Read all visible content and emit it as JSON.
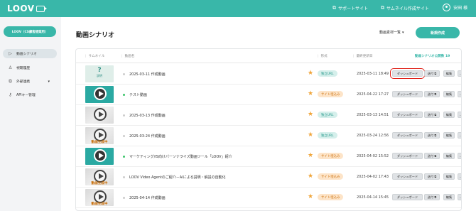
{
  "header": {
    "logo": "LOOV",
    "links": [
      "サポートサイト",
      "サムネイル作成サイト"
    ],
    "user_name": "安田 様"
  },
  "sidebar": {
    "org_label": "LOOV（CS顧客提案用）",
    "items": [
      {
        "label": "動画シナリオ",
        "icon": "play-circle-icon",
        "active": true
      },
      {
        "label": "視聴履歴",
        "icon": "users-icon",
        "active": false
      },
      {
        "label": "外部連携",
        "icon": "external-link-icon",
        "active": false
      },
      {
        "label": "APIキー管理",
        "icon": "key-icon",
        "active": false
      }
    ]
  },
  "main": {
    "title": "動画シナリオ",
    "assets_link": "動画素材一覧",
    "new_button": "新規作成",
    "columns": {
      "thumbnail": "サムネイル",
      "name": "動画名",
      "format": "形式",
      "updated": "最終更新日",
      "public_count": "動画シナリオ公開数",
      "public_count_value": "19"
    },
    "row_buttons": {
      "dashboard": "ダッシュボード",
      "send": "送付",
      "edit": "編集",
      "more": "…"
    },
    "thumb_question_mark": "?",
    "thumb_question_text": "説明",
    "generating_text": "動画生成中",
    "rows": [
      {
        "thumb": "question",
        "dot": "gray",
        "name": "2025-03-11 作成動画",
        "format": "独立URL",
        "format_type": "ind",
        "date": "2025-03-11 18:49",
        "highlight": true
      },
      {
        "thumb": "video",
        "dot": "green",
        "name": "テスト動画",
        "format": "サイト埋込み",
        "format_type": "site",
        "date": "2025-04-22 17:27",
        "highlight": false
      },
      {
        "thumb": "blur",
        "dot": "gray",
        "name": "2025-03-13 作成動画",
        "format": "独立URL",
        "format_type": "ind",
        "date": "2025-03-13 14:51",
        "highlight": false
      },
      {
        "thumb": "generating",
        "dot": "gray",
        "name": "2025-03-24 作成動画",
        "format": "独立URL",
        "format_type": "ind",
        "date": "2025-03-24 12:56",
        "highlight": false
      },
      {
        "thumb": "video",
        "dot": "green",
        "name": "マーケティング/IS向けパーソナライズ動画ツール「LOOV」紹介",
        "format": "サイト埋込み",
        "format_type": "site",
        "date": "2025-04-02 15:52",
        "highlight": false
      },
      {
        "thumb": "generating",
        "dot": "gray",
        "name": "LOOV Video Agentのご紹介－AIによる説明・解説の自動化",
        "format": "サイト埋込み",
        "format_type": "site",
        "date": "2025-04-02 17:43",
        "highlight": false
      },
      {
        "thumb": "generating",
        "dot": "gray",
        "name": "2025-04-14 作成動画",
        "format": "サイト埋込み",
        "format_type": "site",
        "date": "2025-04-14 15:45",
        "highlight": false
      }
    ]
  },
  "colors": {
    "accent": "#39b7a9",
    "highlight": "#e0221a",
    "star": "#f0a53a"
  }
}
